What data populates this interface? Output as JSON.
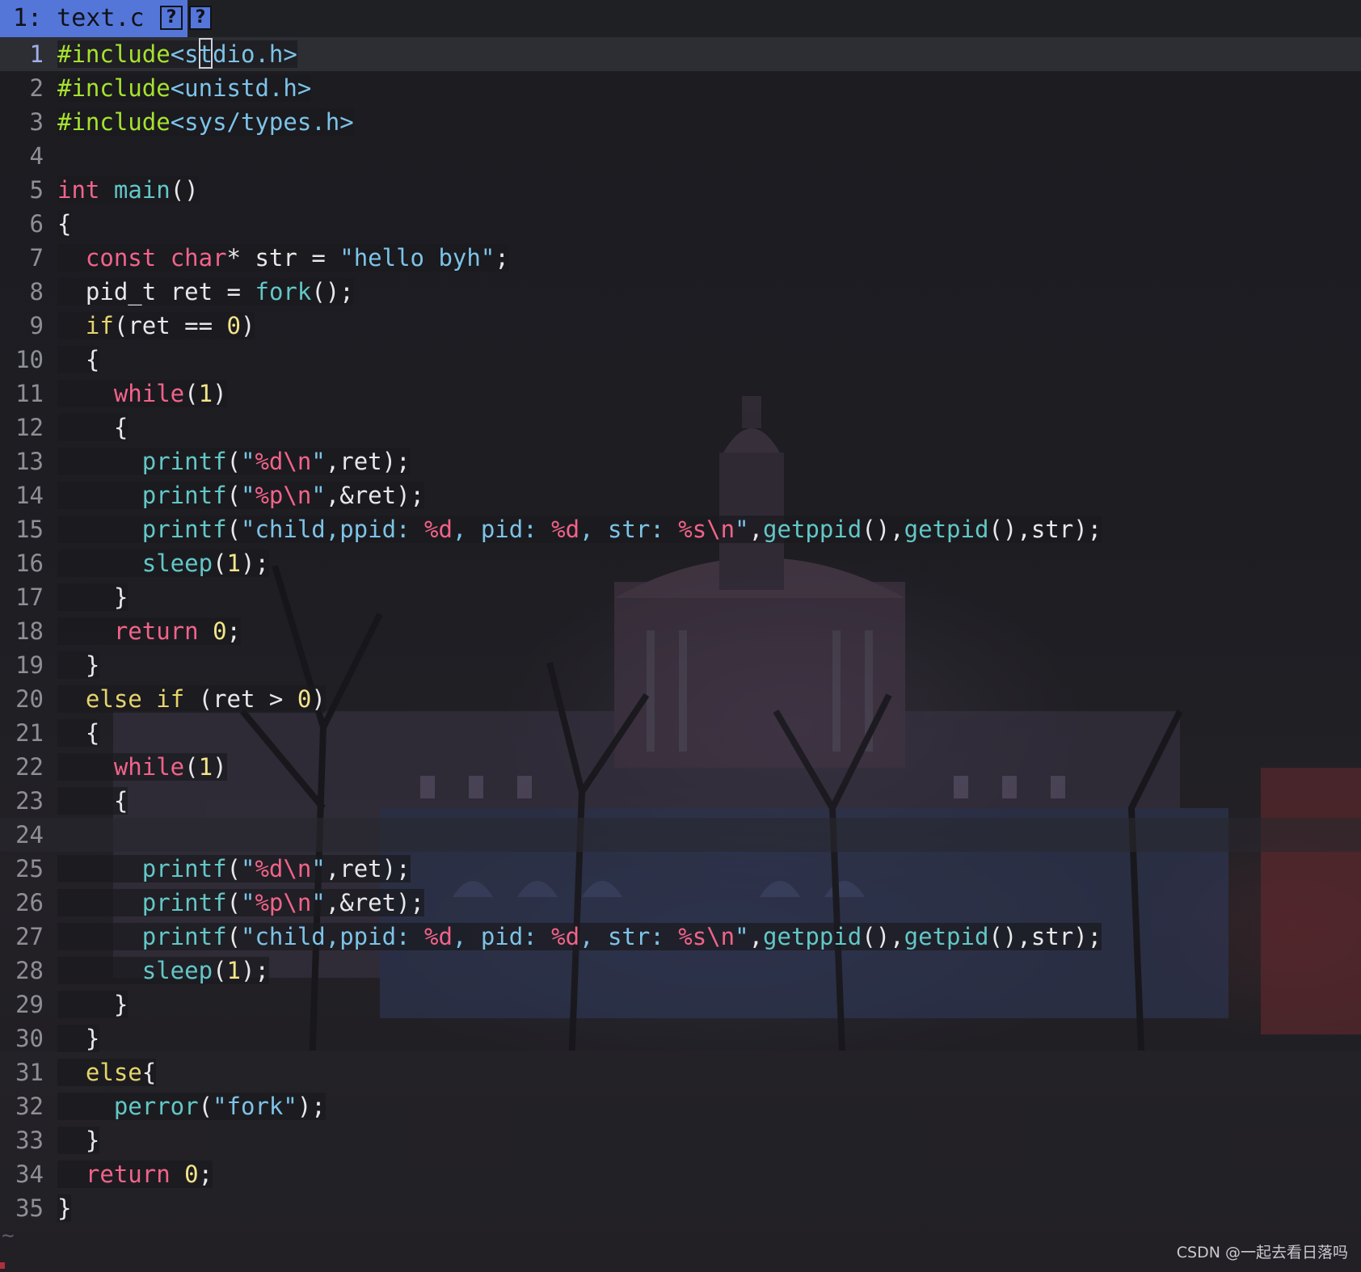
{
  "tabline": {
    "tab_label": "1: text.c",
    "icon_1": "?",
    "icon_2": "?"
  },
  "editor": {
    "language": "c",
    "cursor_line": 1,
    "lines": [
      {
        "n": "1",
        "text": "#include<stdio.h>"
      },
      {
        "n": "2",
        "text": "#include<unistd.h>"
      },
      {
        "n": "3",
        "text": "#include<sys/types.h>"
      },
      {
        "n": "4",
        "text": ""
      },
      {
        "n": "5",
        "text": "int main()"
      },
      {
        "n": "6",
        "text": "{"
      },
      {
        "n": "7",
        "text": "  const char* str = \"hello byh\";"
      },
      {
        "n": "8",
        "text": "  pid_t ret = fork();"
      },
      {
        "n": "9",
        "text": "  if(ret == 0)"
      },
      {
        "n": "10",
        "text": "  {"
      },
      {
        "n": "11",
        "text": "    while(1)"
      },
      {
        "n": "12",
        "text": "    {"
      },
      {
        "n": "13",
        "text": "      printf(\"%d\\n\",ret);"
      },
      {
        "n": "14",
        "text": "      printf(\"%p\\n\",&ret);"
      },
      {
        "n": "15",
        "text": "      printf(\"child,ppid: %d, pid: %d, str: %s\\n\",getppid(),getpid(),str);"
      },
      {
        "n": "16",
        "text": "      sleep(1);"
      },
      {
        "n": "17",
        "text": "    }"
      },
      {
        "n": "18",
        "text": "    return 0;"
      },
      {
        "n": "19",
        "text": "  }"
      },
      {
        "n": "20",
        "text": "  else if (ret > 0)"
      },
      {
        "n": "21",
        "text": "  {"
      },
      {
        "n": "22",
        "text": "    while(1)"
      },
      {
        "n": "23",
        "text": "    {"
      },
      {
        "n": "24",
        "text": ""
      },
      {
        "n": "25",
        "text": "      printf(\"%d\\n\",ret);"
      },
      {
        "n": "26",
        "text": "      printf(\"%p\\n\",&ret);"
      },
      {
        "n": "27",
        "text": "      printf(\"child,ppid: %d, pid: %d, str: %s\\n\",getppid(),getpid(),str);"
      },
      {
        "n": "28",
        "text": "      sleep(1);"
      },
      {
        "n": "29",
        "text": "    }"
      },
      {
        "n": "30",
        "text": "  }"
      },
      {
        "n": "31",
        "text": "  else{"
      },
      {
        "n": "32",
        "text": "    perror(\"fork\");"
      },
      {
        "n": "33",
        "text": "  }"
      },
      {
        "n": "34",
        "text": "  return 0;"
      },
      {
        "n": "35",
        "text": "}"
      }
    ],
    "end_of_buffer_marker": "~"
  },
  "watermark": "CSDN @一起去看日落吗",
  "colors": {
    "tab_active": "#5576d9",
    "background": "#1a1b1f",
    "keyword": "#f2638a",
    "function": "#63c7c7",
    "string": "#7dc3e8",
    "number": "#f3e48a",
    "preprocessor": "#a6e22e"
  }
}
